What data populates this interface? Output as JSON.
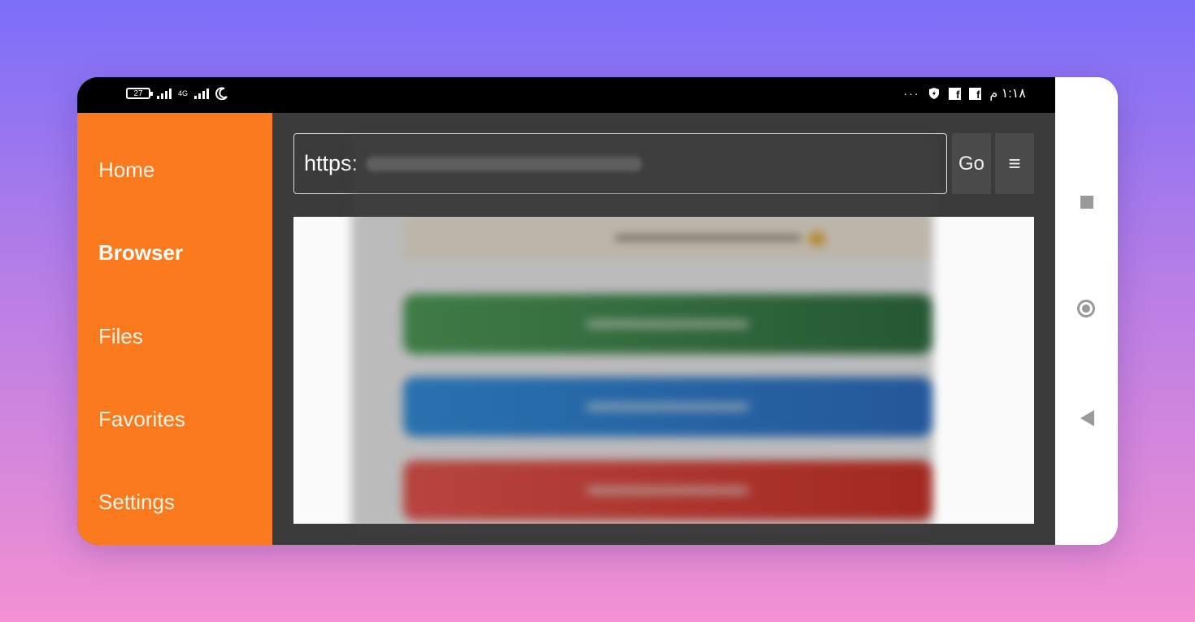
{
  "status_bar": {
    "battery": "27",
    "network": "4G",
    "time": "١:١٨ م",
    "more": "···"
  },
  "sidebar": {
    "items": [
      {
        "label": "Home",
        "active": false
      },
      {
        "label": "Browser",
        "active": true
      },
      {
        "label": "Files",
        "active": false
      },
      {
        "label": "Favorites",
        "active": false
      },
      {
        "label": "Settings",
        "active": false
      }
    ]
  },
  "browser": {
    "url_visible": "https:",
    "go_label": "Go",
    "menu_icon": "≡"
  },
  "colors": {
    "sidebar": "#fc7a1e",
    "content_bg": "#3b3b3b",
    "green_button": "#2e8b3d",
    "blue_button": "#1a7ee0",
    "red_button": "#e8302a"
  },
  "system_nav": {
    "icons": [
      "recent-apps-icon",
      "home-icon",
      "back-icon"
    ]
  }
}
